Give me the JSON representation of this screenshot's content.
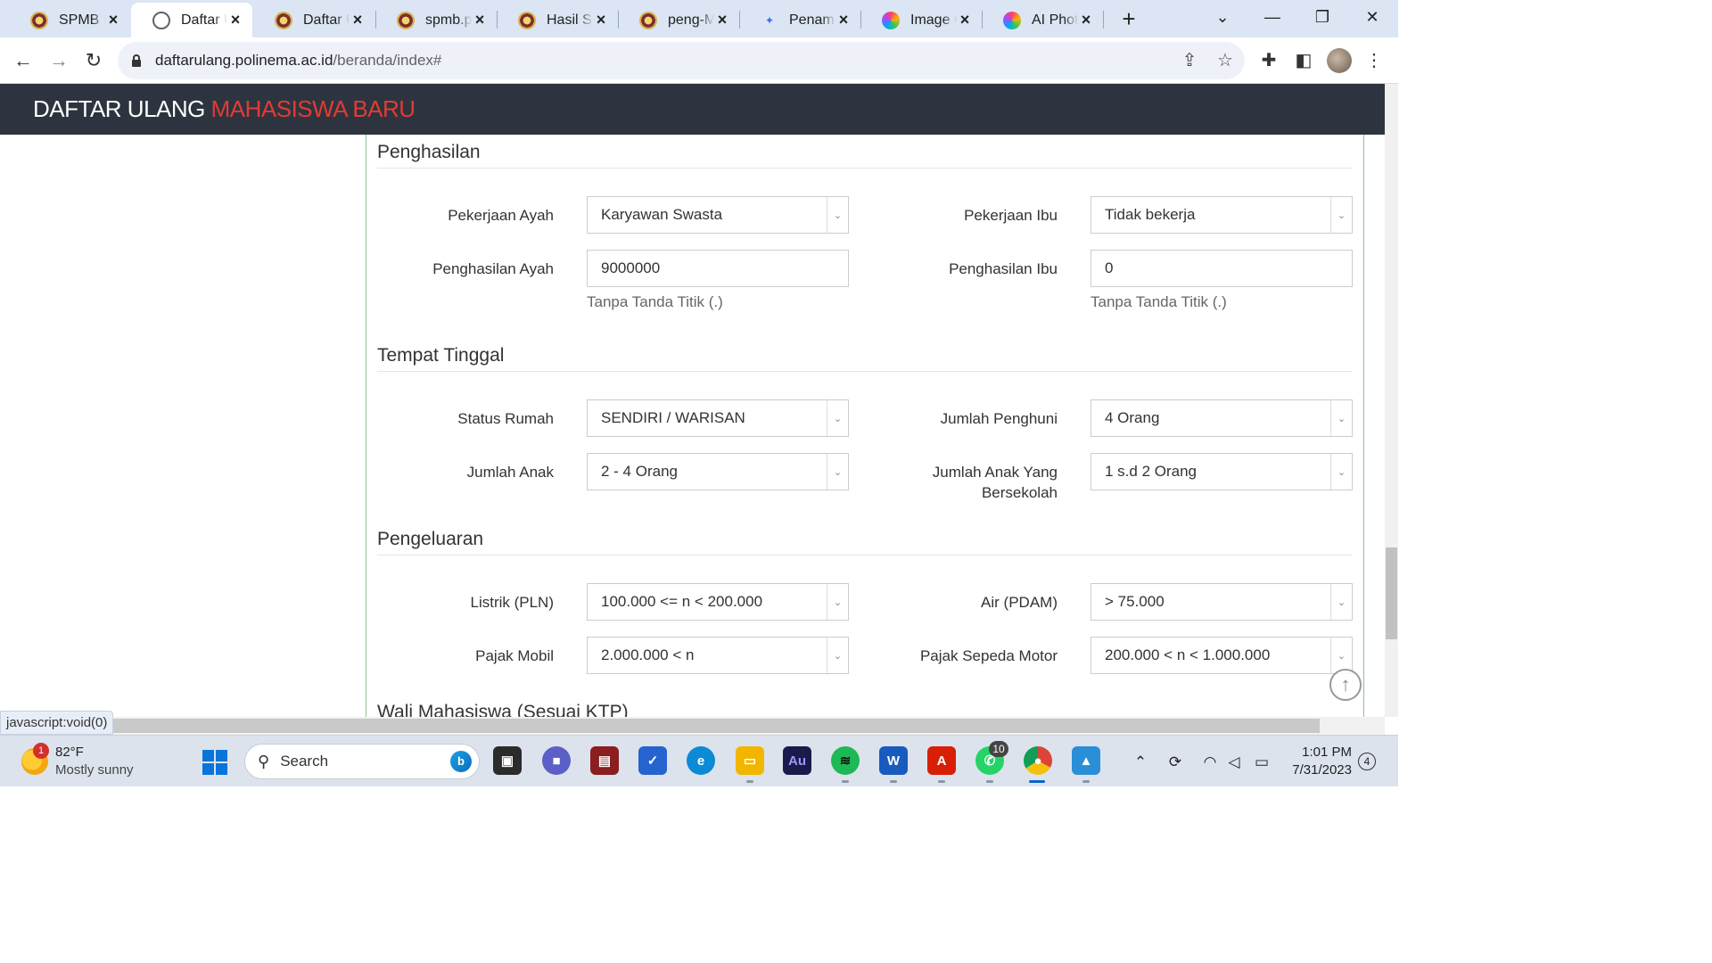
{
  "browser": {
    "tabs": [
      {
        "title": "SPMB PC",
        "favicon": "seal-icon",
        "active": false
      },
      {
        "title": "Daftar Ul",
        "favicon": "globe-icon",
        "active": true
      },
      {
        "title": "Daftar Ul",
        "favicon": "seal-icon",
        "active": false
      },
      {
        "title": "spmb.po",
        "favicon": "seal-icon",
        "active": false
      },
      {
        "title": "Hasil Sel",
        "favicon": "seal-icon",
        "active": false
      },
      {
        "title": "peng-Ma",
        "favicon": "seal-icon",
        "active": false
      },
      {
        "title": "Penamba",
        "favicon": "ai-star-icon",
        "active": false
      },
      {
        "title": "Image Cr",
        "favicon": "rainbow-app-icon",
        "active": false
      },
      {
        "title": "AI Photo",
        "favicon": "rainbow-app-icon",
        "active": false
      }
    ],
    "url_host": "daftarulang.polinema.ac.id",
    "url_path": "/beranda/index#",
    "status_url": "javascript:void(0)"
  },
  "page": {
    "brand_main": "DAFTAR ULANG ",
    "brand_accent": "MAHASISWA BARU",
    "accent_color": "#e23b33"
  },
  "sections": {
    "penghasilan": {
      "title": "Penghasilan",
      "pekerjaan_ayah_label": "Pekerjaan Ayah",
      "pekerjaan_ayah_value": "Karyawan Swasta",
      "pekerjaan_ibu_label": "Pekerjaan Ibu",
      "pekerjaan_ibu_value": "Tidak bekerja",
      "penghasilan_ayah_label": "Penghasilan Ayah",
      "penghasilan_ayah_value": "9000000",
      "penghasilan_ibu_label": "Penghasilan Ibu",
      "penghasilan_ibu_value": "0",
      "help_text": "Tanpa Tanda Titik (.)"
    },
    "tempat_tinggal": {
      "title": "Tempat Tinggal",
      "status_rumah_label": "Status Rumah",
      "status_rumah_value": "SENDIRI / WARISAN",
      "jumlah_penghuni_label": "Jumlah Penghuni",
      "jumlah_penghuni_value": "4 Orang",
      "jumlah_anak_label": "Jumlah Anak",
      "jumlah_anak_value": "2 - 4 Orang",
      "jumlah_anak_sekolah_label_1": "Jumlah Anak Yang",
      "jumlah_anak_sekolah_label_2": "Bersekolah",
      "jumlah_anak_sekolah_value": "1 s.d 2 Orang"
    },
    "pengeluaran": {
      "title": "Pengeluaran",
      "listrik_label": "Listrik (PLN)",
      "listrik_value": "100.000 <= n < 200.000",
      "air_label": "Air (PDAM)",
      "air_value": "> 75.000",
      "pajak_mobil_label": "Pajak Mobil",
      "pajak_mobil_value": "2.000.000 < n",
      "pajak_motor_label": "Pajak Sepeda Motor",
      "pajak_motor_value": "200.000 < n < 1.000.000"
    },
    "wali": {
      "title": "Wali Mahasiswa (Sesuai KTP)"
    }
  },
  "taskbar": {
    "weather_temp": "82°F",
    "weather_desc": "Mostly sunny",
    "weather_badge": "1",
    "search_placeholder": "Search",
    "whatsapp_badge": "10",
    "time": "1:01 PM",
    "date": "7/31/2023",
    "notification_count": "4"
  }
}
